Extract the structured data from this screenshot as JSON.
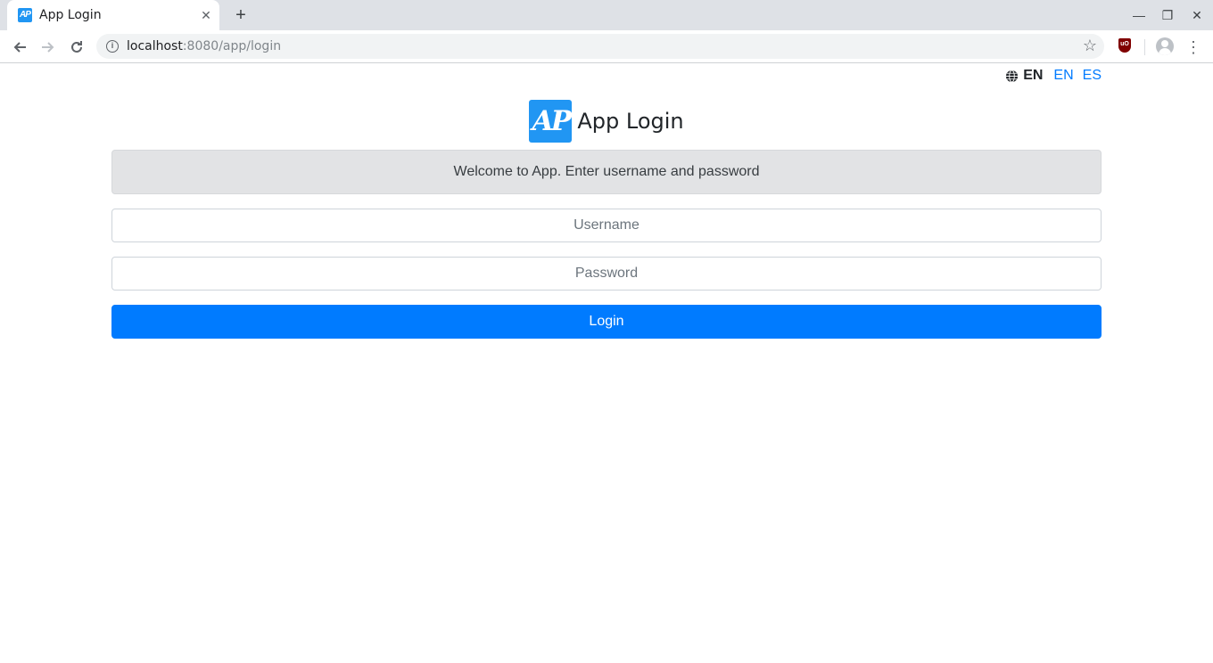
{
  "browser": {
    "tab_title": "App Login",
    "favicon_text": "AP",
    "new_tab": "+",
    "close_tab": "✕",
    "url_host": "localhost",
    "url_rest": ":8080/app/login",
    "ext_badge": "uO",
    "window_controls": {
      "minimize": "—",
      "restore": "❐",
      "close": "✕"
    }
  },
  "page": {
    "language": {
      "current": "EN",
      "options": [
        "EN",
        "ES"
      ]
    },
    "brand": {
      "logo_text": "AP",
      "title": "App Login",
      "logo_color": "#2196f3"
    },
    "welcome_message": "Welcome to App. Enter username and password",
    "form": {
      "username_placeholder": "Username",
      "password_placeholder": "Password",
      "username_value": "",
      "password_value": "",
      "login_label": "Login"
    },
    "colors": {
      "primary": "#007bff",
      "alert_bg": "#e2e3e5"
    }
  }
}
